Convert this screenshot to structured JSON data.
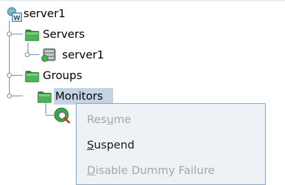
{
  "tree": {
    "root": {
      "label": "server1",
      "icon": "cluster-icon"
    },
    "nodes": [
      {
        "label": "Servers",
        "icon": "folder-icon"
      },
      {
        "label": "server1",
        "icon": "server-icon"
      },
      {
        "label": "Groups",
        "icon": "folder-icon"
      },
      {
        "label": "Monitors",
        "icon": "folder-icon"
      }
    ],
    "monitor_child": {
      "icon": "monitor-icon"
    }
  },
  "context_menu": {
    "items": [
      {
        "pre": "Res",
        "mnemonic": "u",
        "post": "me",
        "enabled": false
      },
      {
        "pre": "",
        "mnemonic": "S",
        "post": "uspend",
        "enabled": true
      },
      {
        "pre": "",
        "mnemonic": "D",
        "post": "isable Dummy Failure",
        "enabled": false
      }
    ]
  },
  "colors": {
    "selection": "#c4d4e4",
    "connector": "#6d8ca9",
    "folder_green": "#3fa64a",
    "menu_bg": "#eef2f6",
    "disabled_text": "#a6a6a6"
  }
}
